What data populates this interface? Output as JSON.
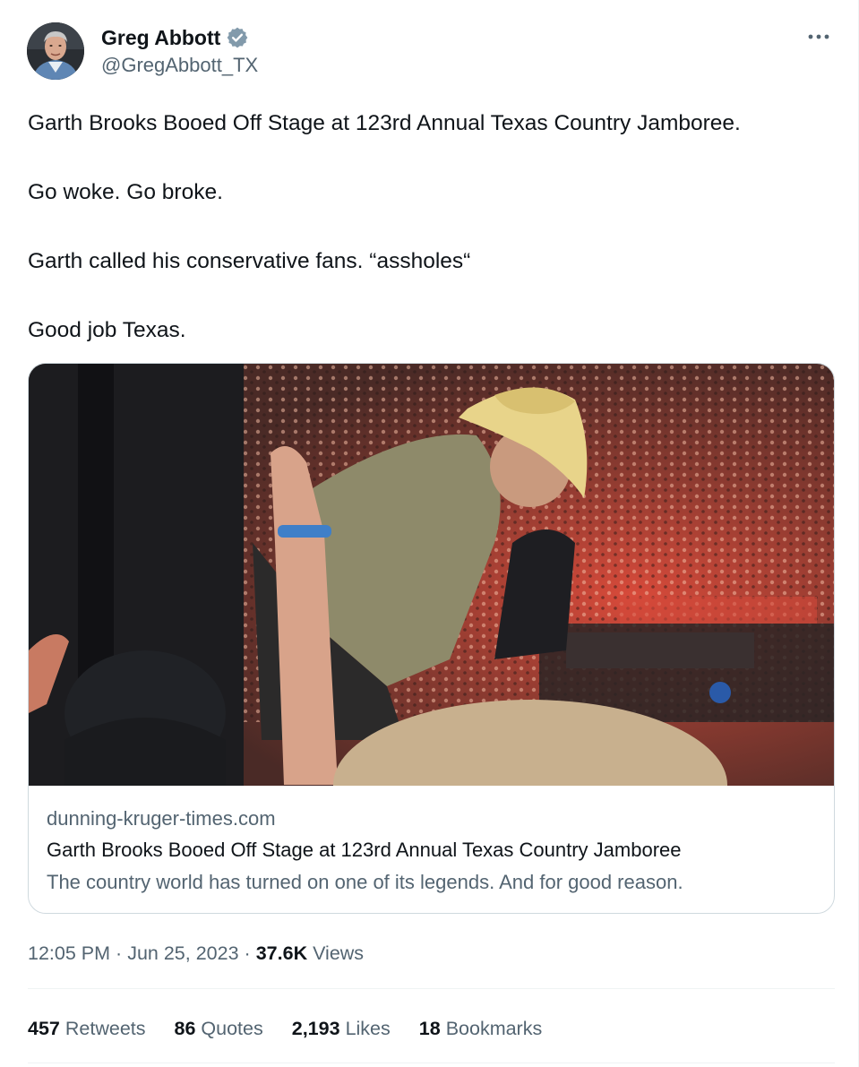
{
  "author": {
    "display_name": "Greg Abbott",
    "handle": "@GregAbbott_TX",
    "verified_icon": "verified-badge-icon",
    "verified_color": "#829aab"
  },
  "tweet": {
    "paragraphs": [
      "Garth Brooks Booed Off Stage at 123rd Annual Texas Country Jamboree.",
      "Go woke. Go broke.",
      "Garth called his conservative fans. “assholes“",
      "Good job Texas."
    ]
  },
  "card": {
    "domain": "dunning-kruger-times.com",
    "title": "Garth Brooks Booed Off Stage at 123rd Annual Texas Country Jamboree",
    "description": "The country world has turned on one of its legends. And for good reason."
  },
  "meta": {
    "time": "12:05 PM",
    "separator": "·",
    "date": "Jun 25, 2023",
    "views_count": "37.6K",
    "views_label": "Views"
  },
  "stats": {
    "retweets_count": "457",
    "retweets_label": "Retweets",
    "quotes_count": "86",
    "quotes_label": "Quotes",
    "likes_count": "2,193",
    "likes_label": "Likes",
    "bookmarks_count": "18",
    "bookmarks_label": "Bookmarks"
  },
  "colors": {
    "text_primary": "#0f1419",
    "text_secondary": "#536471",
    "border": "#cfd9de"
  }
}
